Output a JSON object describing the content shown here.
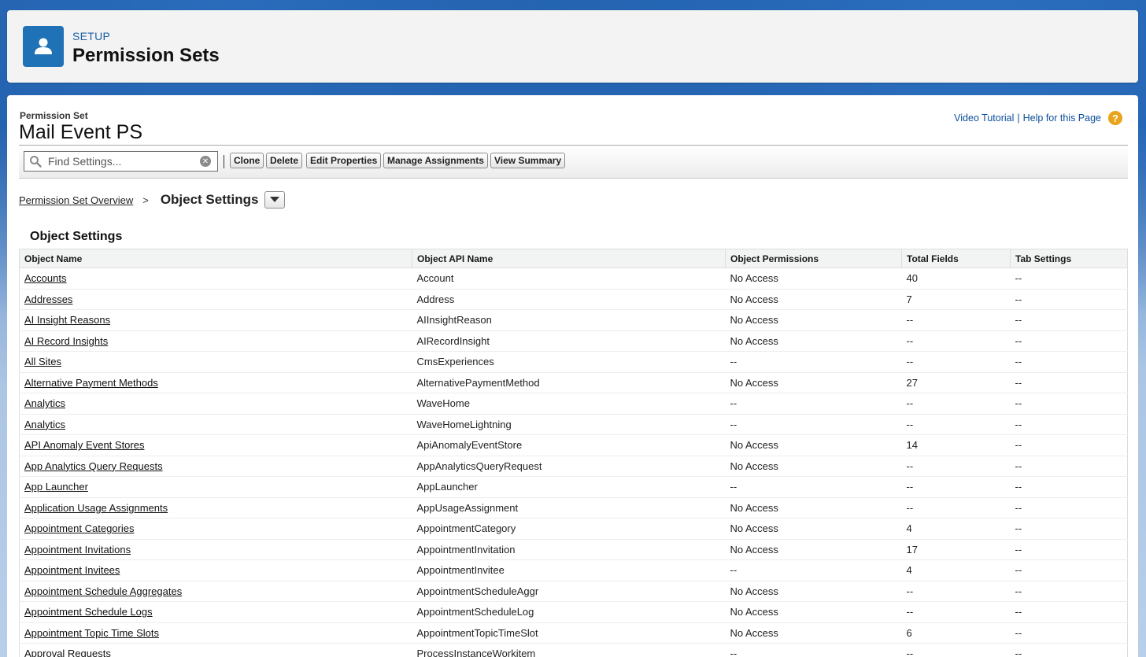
{
  "header": {
    "eyebrow": "SETUP",
    "title": "Permission Sets"
  },
  "permission_set": {
    "label": "Permission Set",
    "name": "Mail Event PS"
  },
  "help": {
    "video_tutorial": "Video Tutorial",
    "separator": "|",
    "help_page": "Help for this Page",
    "help_icon": "?"
  },
  "toolbar": {
    "search_placeholder": "Find Settings...",
    "clone": "Clone",
    "delete": "Delete",
    "edit_properties": "Edit Properties",
    "manage_assignments": "Manage Assignments",
    "view_summary": "View Summary"
  },
  "breadcrumb": {
    "parent": "Permission Set Overview",
    "separator": ">",
    "current": "Object Settings"
  },
  "section": {
    "title": "Object Settings"
  },
  "table": {
    "headers": [
      "Object Name",
      "Object API Name",
      "Object Permissions",
      "Total Fields",
      "Tab Settings"
    ],
    "rows": [
      [
        "Accounts",
        "Account",
        "No Access",
        "40",
        "--"
      ],
      [
        "Addresses",
        "Address",
        "No Access",
        "7",
        "--"
      ],
      [
        "AI Insight Reasons",
        "AIInsightReason",
        "No Access",
        "--",
        "--"
      ],
      [
        "AI Record Insights",
        "AIRecordInsight",
        "No Access",
        "--",
        "--"
      ],
      [
        "All Sites",
        "CmsExperiences",
        "--",
        "--",
        "--"
      ],
      [
        "Alternative Payment Methods",
        "AlternativePaymentMethod",
        "No Access",
        "27",
        "--"
      ],
      [
        "Analytics",
        "WaveHome",
        "--",
        "--",
        "--"
      ],
      [
        "Analytics",
        "WaveHomeLightning",
        "--",
        "--",
        "--"
      ],
      [
        "API Anomaly Event Stores",
        "ApiAnomalyEventStore",
        "No Access",
        "14",
        "--"
      ],
      [
        "App Analytics Query Requests",
        "AppAnalyticsQueryRequest",
        "No Access",
        "--",
        "--"
      ],
      [
        "App Launcher",
        "AppLauncher",
        "--",
        "--",
        "--"
      ],
      [
        "Application Usage Assignments",
        "AppUsageAssignment",
        "No Access",
        "--",
        "--"
      ],
      [
        "Appointment Categories",
        "AppointmentCategory",
        "No Access",
        "4",
        "--"
      ],
      [
        "Appointment Invitations",
        "AppointmentInvitation",
        "No Access",
        "17",
        "--"
      ],
      [
        "Appointment Invitees",
        "AppointmentInvitee",
        "--",
        "4",
        "--"
      ],
      [
        "Appointment Schedule Aggregates",
        "AppointmentScheduleAggr",
        "No Access",
        "--",
        "--"
      ],
      [
        "Appointment Schedule Logs",
        "AppointmentScheduleLog",
        "No Access",
        "--",
        "--"
      ],
      [
        "Appointment Topic Time Slots",
        "AppointmentTopicTimeSlot",
        "No Access",
        "6",
        "--"
      ],
      [
        "Approval Requests",
        "ProcessInstanceWorkitem",
        "--",
        "--",
        "--"
      ]
    ]
  },
  "colors": {
    "brand_blue": "#1f72b5",
    "link_blue": "#0b4e9a",
    "help_orange": "#e8a41a"
  }
}
